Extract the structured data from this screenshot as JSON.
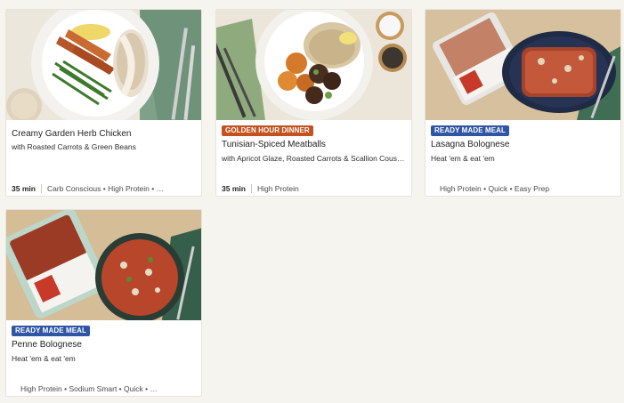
{
  "cards": [
    {
      "badge": "",
      "title": "Creamy Garden Herb Chicken",
      "subtitle": "with Roasted Carrots & Green Beans",
      "time": "35 min",
      "tags": "Carb Conscious • High Protein • …"
    },
    {
      "badge": "GOLDEN HOUR DINNER",
      "title": "Tunisian-Spiced Meatballs",
      "subtitle": "with Apricot Glaze, Roasted Carrots & Scallion Cous…",
      "time": "35 min",
      "tags": "High Protein"
    },
    {
      "badge": "READY MADE MEAL",
      "title": "Lasagna Bolognese",
      "subtitle": "Heat 'em & eat 'em",
      "time": "",
      "tags": "High Protein • Quick • Easy Prep"
    },
    {
      "badge": "READY MADE MEAL",
      "title": "Penne Bolognese",
      "subtitle": "Heat 'em & eat 'em",
      "time": "",
      "tags": "High Protein • Sodium Smart • Quick • …"
    }
  ],
  "colors": {
    "golden_badge": "#c4521f",
    "ready_badge": "#2f55a4",
    "page_bg": "#f6f4ef"
  }
}
